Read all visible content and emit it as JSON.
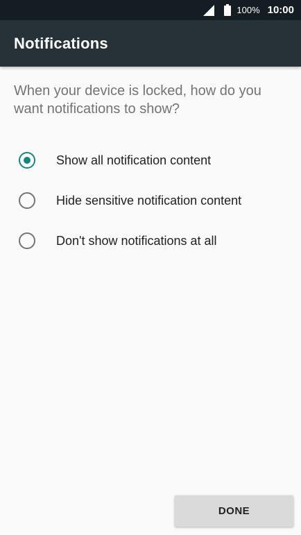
{
  "status_bar": {
    "signal_icon": "cell-signal-icon",
    "battery_icon": "battery-icon",
    "battery_percent": "100%",
    "time": "10:00"
  },
  "app_bar": {
    "title": "Notifications"
  },
  "question": "When your device is locked, how do you want notifications to show?",
  "options": [
    {
      "label": "Show all notification content",
      "selected": true
    },
    {
      "label": "Hide sensitive notification content",
      "selected": false
    },
    {
      "label": "Don't show notifications at all",
      "selected": false
    }
  ],
  "done_label": "DONE",
  "colors": {
    "status_bar": "#141d21",
    "app_bar": "#263238",
    "accent": "#14877d",
    "background": "#fafafa",
    "button": "#dadada"
  }
}
